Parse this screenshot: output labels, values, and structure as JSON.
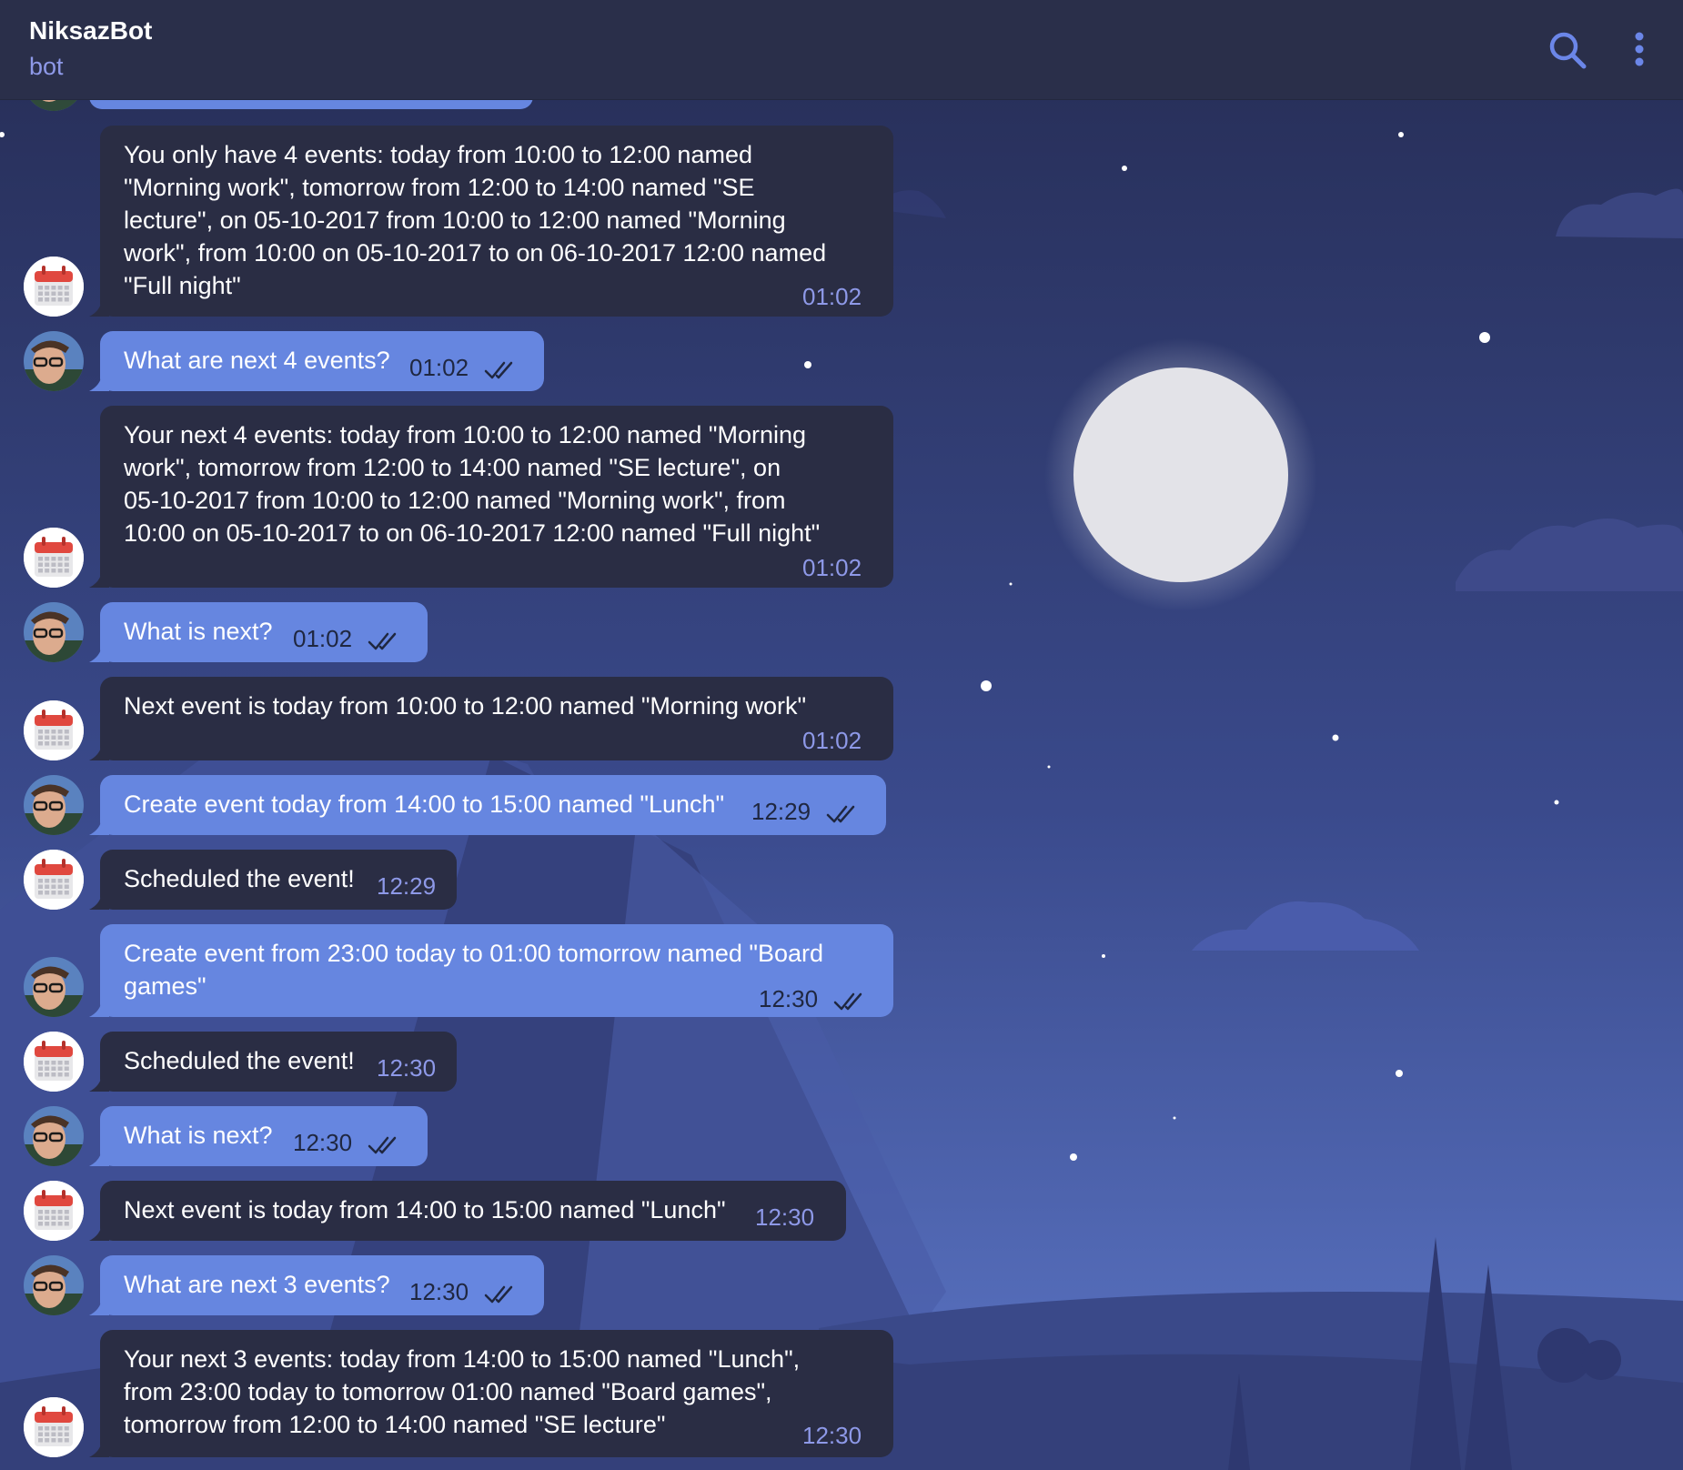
{
  "header": {
    "title": "NiksazBot",
    "subtitle": "bot"
  },
  "messages": [
    {
      "dir": "in",
      "text": "You only have 4 events: today from 10:00 to 12:00 named\n\"Morning work\", tomorrow from 12:00 to 14:00 named \"SE\nlecture\", on 05-10-2017 from 10:00 to 12:00 named \"Morning\nwork\", from 10:00 on 05-10-2017 to on 06-10-2017 12:00 named\n\"Full night\"",
      "time": "01:02"
    },
    {
      "dir": "out",
      "text": "What are next 4 events?",
      "time": "01:02"
    },
    {
      "dir": "in",
      "text": "Your next 4 events: today from 10:00 to 12:00 named \"Morning\nwork\", tomorrow from 12:00 to 14:00 named \"SE lecture\", on\n05-10-2017 from 10:00 to 12:00 named \"Morning work\", from\n10:00 on 05-10-2017 to on 06-10-2017 12:00 named \"Full night\"",
      "time": "01:02"
    },
    {
      "dir": "out",
      "text": "What is next?",
      "time": "01:02"
    },
    {
      "dir": "in",
      "text": "Next event is today from 10:00 to 12:00 named \"Morning work\"",
      "time": "01:02"
    },
    {
      "dir": "out",
      "text": "Create event today from 14:00 to 15:00 named \"Lunch\"",
      "time": "12:29"
    },
    {
      "dir": "in",
      "text": "Scheduled the event!",
      "time": "12:29"
    },
    {
      "dir": "out",
      "text": "Create event from 23:00 today to 01:00 tomorrow named \"Board\ngames\"",
      "time": "12:30"
    },
    {
      "dir": "in",
      "text": "Scheduled the event!",
      "time": "12:30"
    },
    {
      "dir": "out",
      "text": "What is next?",
      "time": "12:30"
    },
    {
      "dir": "in",
      "text": "Next event is today from 14:00 to 15:00 named \"Lunch\"",
      "time": "12:30"
    },
    {
      "dir": "out",
      "text": "What are next 3 events?",
      "time": "12:30"
    },
    {
      "dir": "in",
      "text": "Your next 3 events: today from 14:00 to 15:00 named \"Lunch\",\nfrom 23:00 today to tomorrow 01:00 named \"Board games\",\ntomorrow from 12:00 to 14:00 named \"SE lecture\"",
      "time": "12:30"
    }
  ],
  "colors": {
    "incoming_bubble": "#2a2d44",
    "outgoing_bubble": "#6686e0",
    "accent": "#8e99e8"
  }
}
